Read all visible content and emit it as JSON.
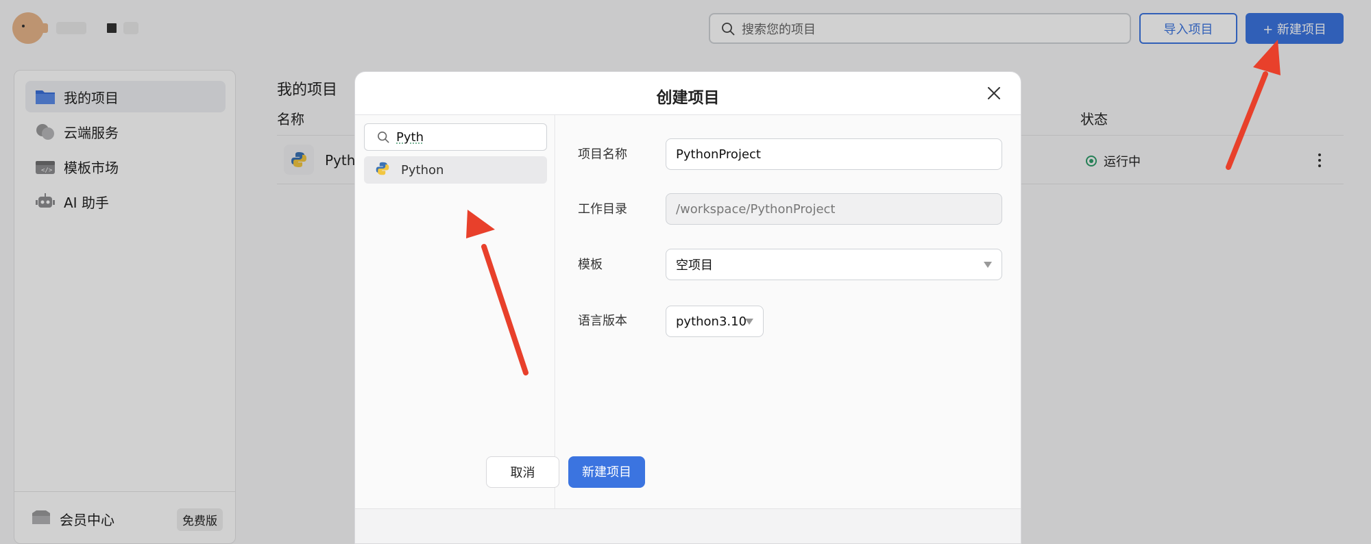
{
  "header": {
    "search_placeholder": "搜索您的项目",
    "import_label": "导入项目",
    "new_label": "+ 新建项目"
  },
  "sidebar": {
    "items": [
      {
        "label": "我的项目",
        "icon": "folder-icon",
        "active": true
      },
      {
        "label": "云端服务",
        "icon": "cloud-icon"
      },
      {
        "label": "模板市场",
        "icon": "template-icon"
      },
      {
        "label": "AI 助手",
        "icon": "ai-icon"
      }
    ],
    "member_label": "会员中心",
    "member_badge": "免费版"
  },
  "main": {
    "title": "我的项目",
    "col_name": "名称",
    "col_status": "状态",
    "row": {
      "name": "Pyth",
      "status": "运行中"
    }
  },
  "modal": {
    "title": "创建项目",
    "template_search_value": "Pyth",
    "template_result": "Python",
    "fields": {
      "name_label": "项目名称",
      "name_value": "PythonProject",
      "dir_label": "工作目录",
      "dir_value": "/workspace/PythonProject",
      "template_label": "模板",
      "template_value": "空项目",
      "lang_label": "语言版本",
      "lang_value": "python3.10"
    },
    "cancel_label": "取消",
    "create_label": "新建项目"
  },
  "colors": {
    "accent": "#3b74e0",
    "status_green": "#2e9c6a",
    "annotation_arrow": "#e8402b"
  }
}
